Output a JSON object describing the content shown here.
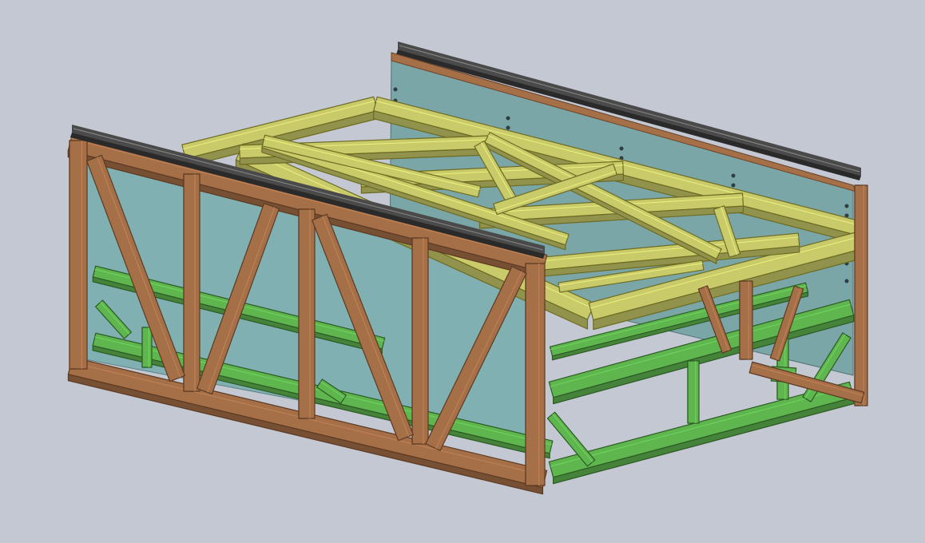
{
  "viewport": {
    "background": "#c4c8d3"
  },
  "model": {
    "parts": [
      {
        "name": "back-glass-panel",
        "color": "#7aa6a8"
      },
      {
        "name": "top-deck-frame",
        "color": "#c9cb6a"
      },
      {
        "name": "outer-truss-frame",
        "color": "#a56f48"
      },
      {
        "name": "base-frame",
        "color": "#5fb64f"
      },
      {
        "name": "linear-rail",
        "color": "#3c3c3c"
      },
      {
        "name": "red-seal-strip",
        "color": "#c76a6a"
      }
    ]
  }
}
